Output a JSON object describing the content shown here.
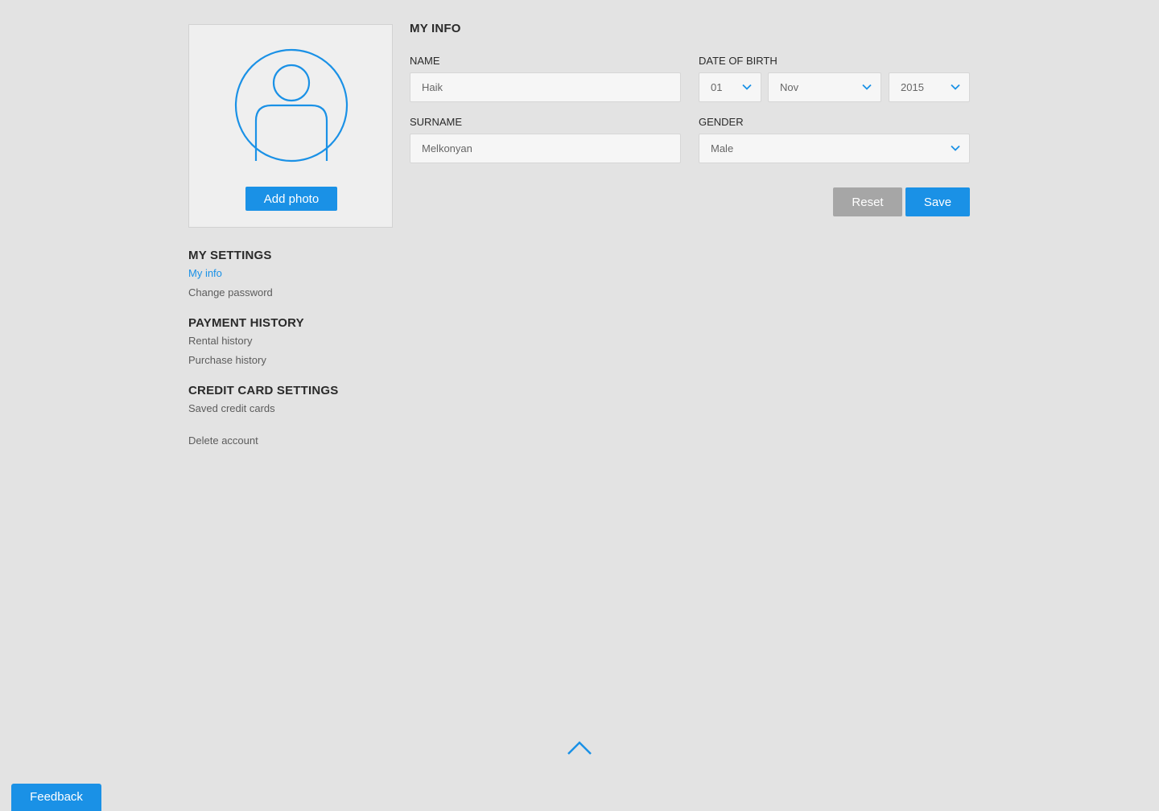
{
  "colors": {
    "accent": "#1a91e6",
    "background": "#e3e3e3",
    "reset_button": "#a6a6a6"
  },
  "avatar": {
    "icon": "user-avatar-icon",
    "add_photo_label": "Add photo"
  },
  "menu": {
    "groups": [
      {
        "heading": "MY SETTINGS",
        "items": [
          {
            "label": "My info",
            "active": true
          },
          {
            "label": "Change password",
            "active": false
          }
        ]
      },
      {
        "heading": "PAYMENT HISTORY",
        "items": [
          {
            "label": "Rental history",
            "active": false
          },
          {
            "label": "Purchase history",
            "active": false
          }
        ]
      },
      {
        "heading": "CREDIT CARD SETTINGS",
        "items": [
          {
            "label": "Saved credit cards",
            "active": false
          }
        ]
      }
    ],
    "delete_account_label": "Delete account"
  },
  "form": {
    "title": "MY INFO",
    "name": {
      "label": "NAME",
      "value": "Haik"
    },
    "surname": {
      "label": "SURNAME",
      "value": "Melkonyan"
    },
    "date_of_birth": {
      "label": "DATE OF BIRTH",
      "day": "01",
      "month": "Nov",
      "year": "2015"
    },
    "gender": {
      "label": "GENDER",
      "value": "Male"
    },
    "reset_label": "Reset",
    "save_label": "Save"
  },
  "scroll_top_icon": "chevron-up-icon",
  "feedback_label": "Feedback"
}
